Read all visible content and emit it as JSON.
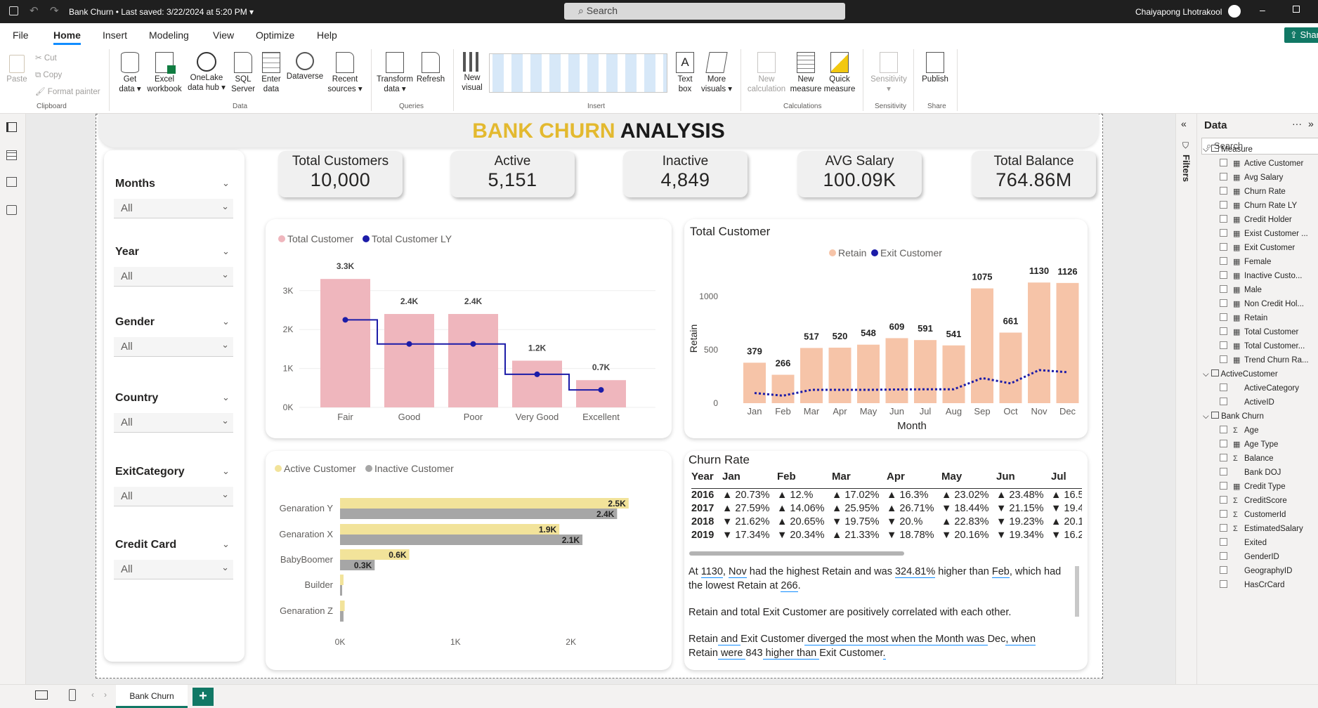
{
  "titlebar": {
    "doc": "Bank Churn",
    "saved": "Last saved: 3/22/2024 at 5:20 PM",
    "search_placeholder": "Search",
    "user": "Chaiyapong Lhotrakool"
  },
  "tabs": [
    "File",
    "Home",
    "Insert",
    "Modeling",
    "View",
    "Optimize",
    "Help"
  ],
  "share": "Share",
  "ribbon": {
    "clipboard": {
      "paste": "Paste",
      "cut": "Cut",
      "copy": "Copy",
      "format": "Format painter",
      "group": "Clipboard"
    },
    "data": {
      "get": "Get",
      "get2": "data",
      "excel": "Excel",
      "excel2": "workbook",
      "onelake": "OneLake",
      "onelake2": "data hub",
      "sql": "SQL",
      "sql2": "Server",
      "enter": "Enter",
      "enter2": "data",
      "dataverse": "Dataverse",
      "recent": "Recent",
      "recent2": "sources",
      "group": "Data"
    },
    "queries": {
      "transform": "Transform",
      "transform2": "data",
      "refresh": "Refresh",
      "group": "Queries"
    },
    "insert": {
      "newvisual": "New",
      "newvisual2": "visual",
      "textbox": "Text",
      "textbox2": "box",
      "more": "More",
      "more2": "visuals",
      "group": "Insert"
    },
    "calc": {
      "newcalc": "New",
      "newcalc2": "calculation",
      "newmeasure": "New",
      "newmeasure2": "measure",
      "quick": "Quick",
      "quick2": "measure",
      "group": "Calculations"
    },
    "sens": {
      "label": "Sensitivity",
      "group": "Sensitivity"
    },
    "share": {
      "publish": "Publish",
      "group": "Share"
    }
  },
  "report": {
    "title_gold": "BANK CHURN",
    "title_black": "ANALYSIS",
    "kpis": [
      {
        "t": "Total Customers",
        "v": "10,000"
      },
      {
        "t": "Active",
        "v": "5,151"
      },
      {
        "t": "Inactive",
        "v": "4,849"
      },
      {
        "t": "AVG Salary",
        "v": "100.09K"
      },
      {
        "t": "Total Balance",
        "v": "764.86M"
      }
    ],
    "slicers": [
      {
        "label": "Months",
        "value": "All"
      },
      {
        "label": "Year",
        "value": "All"
      },
      {
        "label": "Gender",
        "value": "All"
      },
      {
        "label": "Country",
        "value": "All"
      },
      {
        "label": "ExitCategory",
        "value": "All"
      },
      {
        "label": "Credit Card",
        "value": "All"
      }
    ],
    "narrative": {
      "p1": [
        "At ",
        "1130",
        ", ",
        "Nov",
        " had the highest Retain and was ",
        "324.81%",
        " higher than ",
        "Feb",
        ", which had the lowest Retain at ",
        "266",
        "."
      ],
      "p2": "Retain and total Exit Customer are positively correlated with each other.",
      "p3": [
        "Retain",
        " and ",
        "Exit Customer",
        " diverged the most when the Month was ",
        "Dec",
        ", when ",
        "Retain",
        " were ",
        "843",
        " higher than ",
        "Exit Customer",
        "."
      ]
    }
  },
  "chart_data": [
    {
      "type": "bar",
      "legend": [
        "Total Customer",
        "Total Customer LY"
      ],
      "categories": [
        "Fair",
        "Good",
        "Poor",
        "Very Good",
        "Excellent"
      ],
      "series": [
        {
          "name": "Total Customer",
          "values": [
            3300,
            2400,
            2400,
            1200,
            700
          ],
          "labels": [
            "3.3K",
            "2.4K",
            "2.4K",
            "1.2K",
            "0.7K"
          ],
          "color": "#efb6bd"
        },
        {
          "name": "Total Customer LY",
          "values": [
            2250,
            1630,
            1630,
            850,
            450
          ],
          "color": "#1c1ca8"
        }
      ],
      "yticks": [
        "0K",
        "1K",
        "2K",
        "3K"
      ],
      "ylim": [
        0,
        3700
      ]
    },
    {
      "type": "bar",
      "title": "Total Customer",
      "legend": [
        "Retain",
        "Exit Customer"
      ],
      "xlabel": "Month",
      "ylabel": "Retain",
      "categories": [
        "Jan",
        "Feb",
        "Mar",
        "Apr",
        "May",
        "Jun",
        "Jul",
        "Aug",
        "Sep",
        "Oct",
        "Nov",
        "Dec"
      ],
      "series": [
        {
          "name": "Retain",
          "values": [
            379,
            266,
            517,
            520,
            548,
            609,
            591,
            541,
            1075,
            661,
            1130,
            1126
          ],
          "color": "#f6c4a8"
        },
        {
          "name": "Exit Customer",
          "values": [
            95,
            70,
            125,
            125,
            125,
            128,
            130,
            130,
            235,
            185,
            310,
            290
          ],
          "color": "#1c1ca8"
        }
      ],
      "yticks": [
        "0",
        "500",
        "1000"
      ],
      "ylim": [
        0,
        1250
      ]
    },
    {
      "type": "bar",
      "orientation": "horizontal",
      "legend": [
        "Active Customer",
        "Inactive Customer"
      ],
      "categories": [
        "Genaration Y",
        "Genaration X",
        "BabyBoomer",
        "Builder",
        "Genaration Z"
      ],
      "series": [
        {
          "name": "Active Customer",
          "values": [
            2500,
            1900,
            600,
            30,
            40
          ],
          "labels": [
            "2.5K",
            "1.9K",
            "0.6K",
            "",
            ""
          ],
          "color": "#f2e39a"
        },
        {
          "name": "Inactive Customer",
          "values": [
            2400,
            2100,
            300,
            10,
            30
          ],
          "labels": [
            "2.4K",
            "2.1K",
            "0.3K",
            "",
            ""
          ],
          "color": "#a6a6a6"
        }
      ],
      "xticks": [
        "0K",
        "1K",
        "2K"
      ],
      "xlim": [
        0,
        2550
      ]
    },
    {
      "type": "table",
      "title": "Churn Rate",
      "columns": [
        "Year",
        "Jan",
        "Feb",
        "Mar",
        "Apr",
        "May",
        "Jun",
        "Jul"
      ],
      "rows": [
        [
          "2016",
          "▲ 20.73%",
          "▲ 12.%",
          "▲ 17.02%",
          "▲ 16.3%",
          "▲ 23.02%",
          "▲ 23.48%",
          "▲ 16.5"
        ],
        [
          "2017",
          "▲ 27.59%",
          "▲ 14.06%",
          "▲ 25.95%",
          "▲ 26.71%",
          "▼ 18.44%",
          "▼ 21.15%",
          "▼ 19.4"
        ],
        [
          "2018",
          "▼ 21.62%",
          "▲ 20.65%",
          "▼ 19.75%",
          "▼ 20.%",
          "▲ 22.83%",
          "▼ 19.23%",
          "▲ 20.1"
        ],
        [
          "2019",
          "▼ 17.34%",
          "▼ 20.34%",
          "▲ 21.33%",
          "▼ 18.78%",
          "▼ 20.16%",
          "▼ 19.34%",
          "▼ 16.2"
        ]
      ]
    }
  ],
  "datapane": {
    "title": "Data",
    "search": "Search",
    "tables": [
      {
        "name": "Measure",
        "fields": [
          "Active Customer",
          "Avg Salary",
          "Churn Rate",
          "Churn Rate LY",
          "Credit Holder",
          "Exist Customer ...",
          "Exit Customer",
          "Female",
          "Inactive Custo...",
          "Male",
          "Non Credit Hol...",
          "Retain",
          "Total Customer",
          "Total Customer...",
          "Trend Churn Ra..."
        ]
      },
      {
        "name": "ActiveCustomer",
        "fields": [
          "ActiveCategory",
          "ActiveID"
        ]
      },
      {
        "name": "Bank Churn",
        "fields": [
          "Age",
          "Age Type",
          "Balance",
          "Bank DOJ",
          "Credit Type",
          "CreditScore",
          "CustomerId",
          "EstimatedSalary",
          "Exited",
          "GenderID",
          "GeographyID",
          "HasCrCard"
        ]
      }
    ]
  },
  "filters_label": "Filters",
  "page_tab": "Bank Churn"
}
